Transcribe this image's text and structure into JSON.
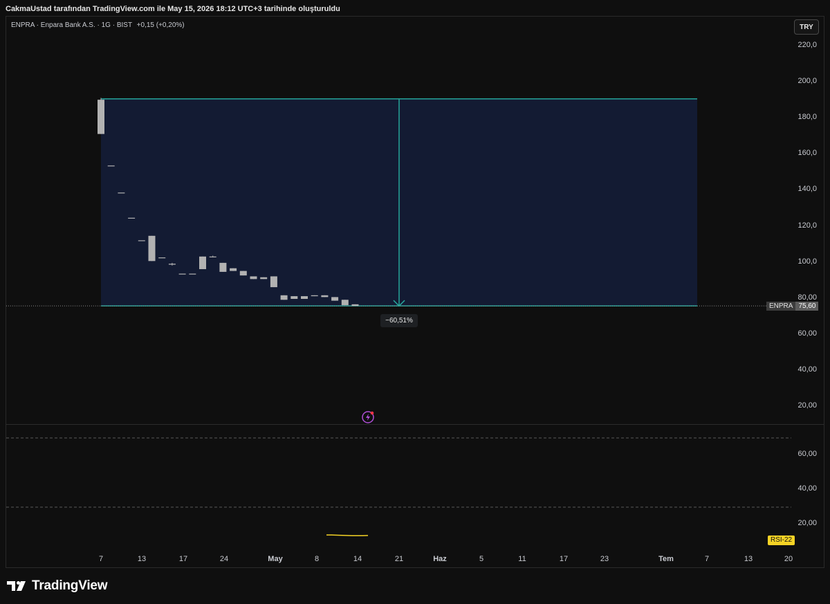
{
  "header": {
    "caption": "CakmaUstad tarafından TradingView.com ile May 15, 2026 18:12 UTC+3 tarihinde oluşturuldu"
  },
  "symbol": {
    "info": "ENPRA · Enpara Bank A.S. · 1G · BIST",
    "change": "+0,15 (+0,20%)",
    "ticker": "ENPRA",
    "last_price": "75,60",
    "currency": "TRY"
  },
  "price_axis": [
    "220,0",
    "200,0",
    "180,0",
    "160,0",
    "140,0",
    "120,0",
    "100,0",
    "80,00",
    "60,00",
    "40,00",
    "20,00"
  ],
  "rsi_axis": [
    "60,00",
    "40,00",
    "20,00"
  ],
  "time_axis": [
    {
      "label": "7",
      "bold": false
    },
    {
      "label": "13",
      "bold": false
    },
    {
      "label": "17",
      "bold": false
    },
    {
      "label": "24",
      "bold": false
    },
    {
      "label": "May",
      "bold": true
    },
    {
      "label": "8",
      "bold": false
    },
    {
      "label": "14",
      "bold": false
    },
    {
      "label": "21",
      "bold": false
    },
    {
      "label": "Haz",
      "bold": true
    },
    {
      "label": "5",
      "bold": false
    },
    {
      "label": "11",
      "bold": false
    },
    {
      "label": "17",
      "bold": false
    },
    {
      "label": "23",
      "bold": false
    },
    {
      "label": "Tem",
      "bold": true
    },
    {
      "label": "7",
      "bold": false
    },
    {
      "label": "13",
      "bold": false
    },
    {
      "label": "20",
      "bold": false
    }
  ],
  "measure": {
    "label": "−60,51%",
    "from_price": 190.5,
    "to_price": 75.6
  },
  "indicator": {
    "label": "RSI-22"
  },
  "footer": {
    "brand": "TradingView"
  },
  "colors": {
    "background": "#0f0f0f",
    "candle": "#b2b2b2",
    "measure_line": "#26a69a",
    "measure_fill": "#131b33",
    "rsi_line": "#f5d325",
    "badge": "#f5d325"
  },
  "chart_data": {
    "type": "candlestick",
    "ylim": [
      0,
      230
    ],
    "candles": [
      {
        "o": 190,
        "h": 191,
        "l": 171,
        "c": 171
      },
      {
        "o": 153.5,
        "h": 153.5,
        "l": 153.5,
        "c": 153.5
      },
      {
        "o": 138.5,
        "h": 138.5,
        "l": 138.5,
        "c": 138.5
      },
      {
        "o": 124.5,
        "h": 124.5,
        "l": 124.5,
        "c": 124.5
      },
      {
        "o": 112,
        "h": 112,
        "l": 112,
        "c": 112
      },
      {
        "o": 114.5,
        "h": 114.5,
        "l": 100.5,
        "c": 100.5
      },
      {
        "o": 102.5,
        "h": 102.5,
        "l": 102.5,
        "c": 102.5
      },
      {
        "o": 99,
        "h": 99.5,
        "l": 98,
        "c": 98.5
      },
      {
        "o": 93.5,
        "h": 93.5,
        "l": 93.5,
        "c": 93.5
      },
      {
        "o": 93.5,
        "h": 93.5,
        "l": 93.5,
        "c": 93.5
      },
      {
        "o": 103,
        "h": 103,
        "l": 96,
        "c": 96
      },
      {
        "o": 103,
        "h": 103.5,
        "l": 102.5,
        "c": 103
      },
      {
        "o": 99.5,
        "h": 99.5,
        "l": 94.5,
        "c": 94.5
      },
      {
        "o": 96.5,
        "h": 96.5,
        "l": 95,
        "c": 95
      },
      {
        "o": 95,
        "h": 95,
        "l": 92.5,
        "c": 92.5
      },
      {
        "o": 92,
        "h": 92,
        "l": 90.5,
        "c": 90.5
      },
      {
        "o": 91.5,
        "h": 91.5,
        "l": 90.5,
        "c": 90.5
      },
      {
        "o": 92,
        "h": 92,
        "l": 86,
        "c": 86
      },
      {
        "o": 81.5,
        "h": 81.5,
        "l": 79,
        "c": 79
      },
      {
        "o": 81,
        "h": 81,
        "l": 79.5,
        "c": 79.5
      },
      {
        "o": 81,
        "h": 81,
        "l": 79.5,
        "c": 79.5
      },
      {
        "o": 81.5,
        "h": 81.5,
        "l": 81,
        "c": 81
      },
      {
        "o": 81.5,
        "h": 81.5,
        "l": 80.5,
        "c": 80.5
      },
      {
        "o": 80.5,
        "h": 80.5,
        "l": 78.5,
        "c": 78.5
      },
      {
        "o": 79,
        "h": 79,
        "l": 76,
        "c": 76
      },
      {
        "o": 76.5,
        "h": 76.5,
        "l": 75.6,
        "c": 75.6
      }
    ],
    "rsi": [
      13.5,
      13.5,
      13.4,
      13.3,
      13.2,
      13.1,
      13.1,
      13.1,
      13.2
    ]
  }
}
